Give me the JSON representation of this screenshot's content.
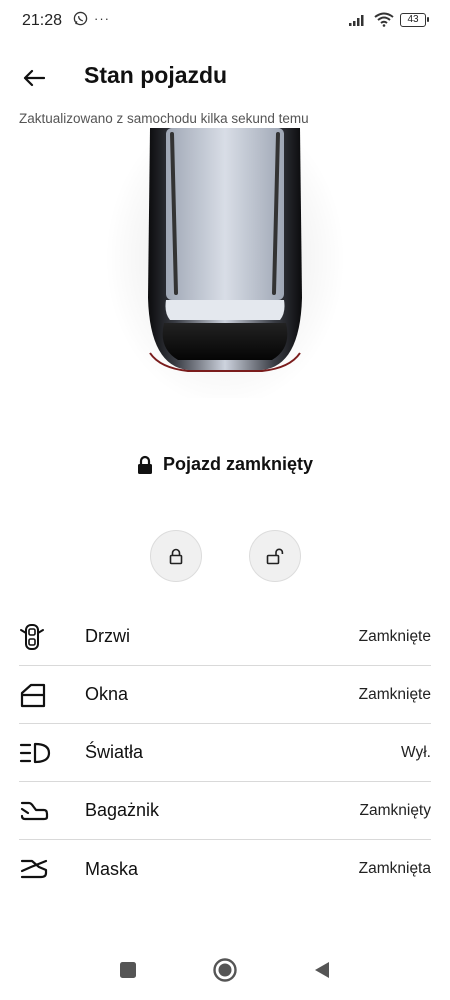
{
  "status_bar": {
    "time": "21:28",
    "battery": "43",
    "more": "···"
  },
  "header": {
    "title": "Stan pojazdu"
  },
  "update_text": "Zaktualizowano z samochodu kilka sekund temu",
  "lock_status": {
    "label": "Pojazd zamknięty",
    "icon": "padlock-icon"
  },
  "actions": [
    {
      "name": "lock",
      "icon": "lock-icon"
    },
    {
      "name": "unlock",
      "icon": "unlock-icon"
    }
  ],
  "status_items": [
    {
      "icon": "door-icon",
      "label": "Drzwi",
      "value": "Zamknięte"
    },
    {
      "icon": "window-icon",
      "label": "Okna",
      "value": "Zamknięte"
    },
    {
      "icon": "headlight-icon",
      "label": "Światła",
      "value": "Wył."
    },
    {
      "icon": "trunk-icon",
      "label": "Bagażnik",
      "value": "Zamknięty"
    },
    {
      "icon": "hood-icon",
      "label": "Maska",
      "value": "Zamknięta"
    }
  ],
  "nav": {
    "recents_icon": "square-icon",
    "home_icon": "circle-icon",
    "back_icon": "triangle-icon"
  }
}
